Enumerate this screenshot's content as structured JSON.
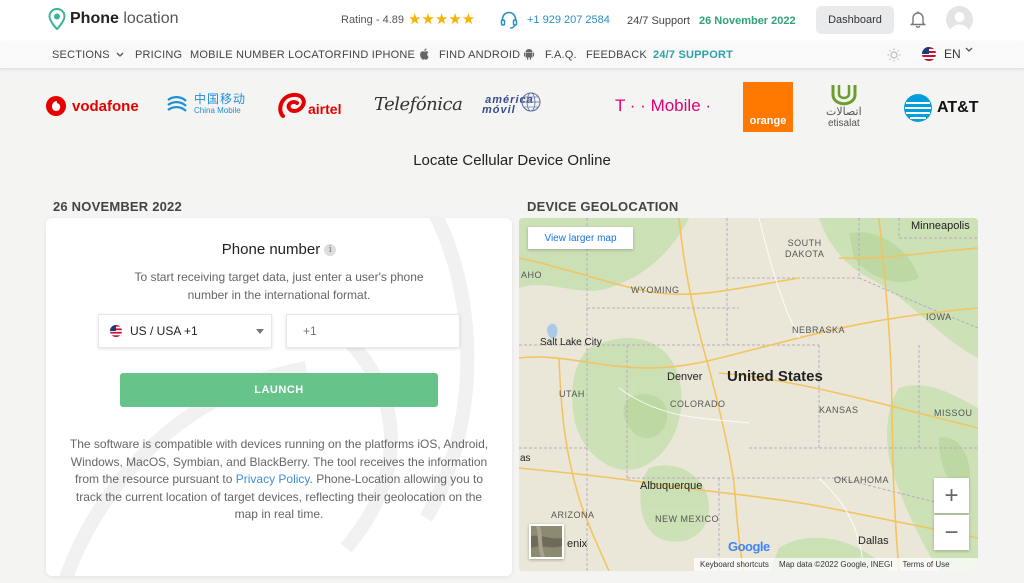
{
  "header": {
    "logo_text_bold": "Phone",
    "logo_text_rest": "location",
    "rating_label": "Rating - 4.89",
    "stars": "★★★★★",
    "phone": "+1 929 207 2584",
    "support": "24/7 Support",
    "date": "26 November 2022",
    "dashboard_label": "Dashboard"
  },
  "nav": {
    "items": [
      "SECTIONS",
      "PRICING",
      "MOBILE NUMBER LOCATOR",
      "FIND IPHONE",
      "FIND ANDROID",
      "F.A.Q.",
      "FEEDBACK",
      "24/7 SUPPORT"
    ],
    "language": "EN"
  },
  "operators": {
    "vodafone": "vodafone",
    "china_mobile_cn": "中国移动",
    "china_mobile_en": "China Mobile",
    "airtel": "airtel",
    "telefonica": "Telefónica",
    "america_movil_1": "américa",
    "america_movil_2": "móvil",
    "tmobile": "T · · Mobile ·",
    "orange": "orange",
    "etisalat_ar": "اتصالات",
    "etisalat": "etisalat",
    "att": "AT&T"
  },
  "main_title": "Locate Cellular Device Online",
  "left_section_title": "26 NOVEMBER 2022",
  "right_section_title": "DEVICE GEOLOCATION",
  "form": {
    "title": "Phone number",
    "info_icon": "i",
    "description": "To start receiving target data, just enter a user's phone number in the international format.",
    "country_value": "US / USA +1",
    "phone_placeholder": "+1",
    "launch_label": "LAUNCH",
    "compat_text_1": "The software is compatible with devices running on the platforms iOS, Android, Windows, MacOS, Symbian, and BlackBerry. The tool receives the information from the resource pursuant to ",
    "privacy_link": "Privacy Policy",
    "compat_text_2": ". Phone-Location allowing you to track the current location of target devices, reflecting their geolocation on the map in real time."
  },
  "map": {
    "view_larger": "View larger map",
    "labels": {
      "minneapolis": "Minneapolis",
      "south_dakota": "SOUTH\nDAKOTA",
      "aho": "AHO",
      "wyoming": "WYOMING",
      "iowa": "IOWA",
      "nebraska": "NEBRASKA",
      "salt_lake": "Salt Lake City",
      "denver": "Denver",
      "united_states": "United States",
      "utah": "UTAH",
      "colorado": "COLORADO",
      "kansas": "KANSAS",
      "missouri": "MISSOU",
      "vegas": "as",
      "albuquerque": "Albuquerque",
      "oklahoma": "OKLAHOMA",
      "arizona": "ARIZONA",
      "new_mexico": "NEW MEXICO",
      "phoenix": "enix",
      "dallas": "Dallas"
    },
    "zoom_in": "+",
    "zoom_out": "−",
    "google": "Google",
    "keyboard_shortcuts": "Keyboard shortcuts",
    "map_data": "Map data ©2022 Google, INEGI",
    "terms": "Terms of Use"
  },
  "colors": {
    "accent_green": "#66c48a",
    "link_blue": "#2c8ec3",
    "date_green": "#2ea37b",
    "support_teal": "#2aa1a8",
    "star": "#f5b400"
  }
}
